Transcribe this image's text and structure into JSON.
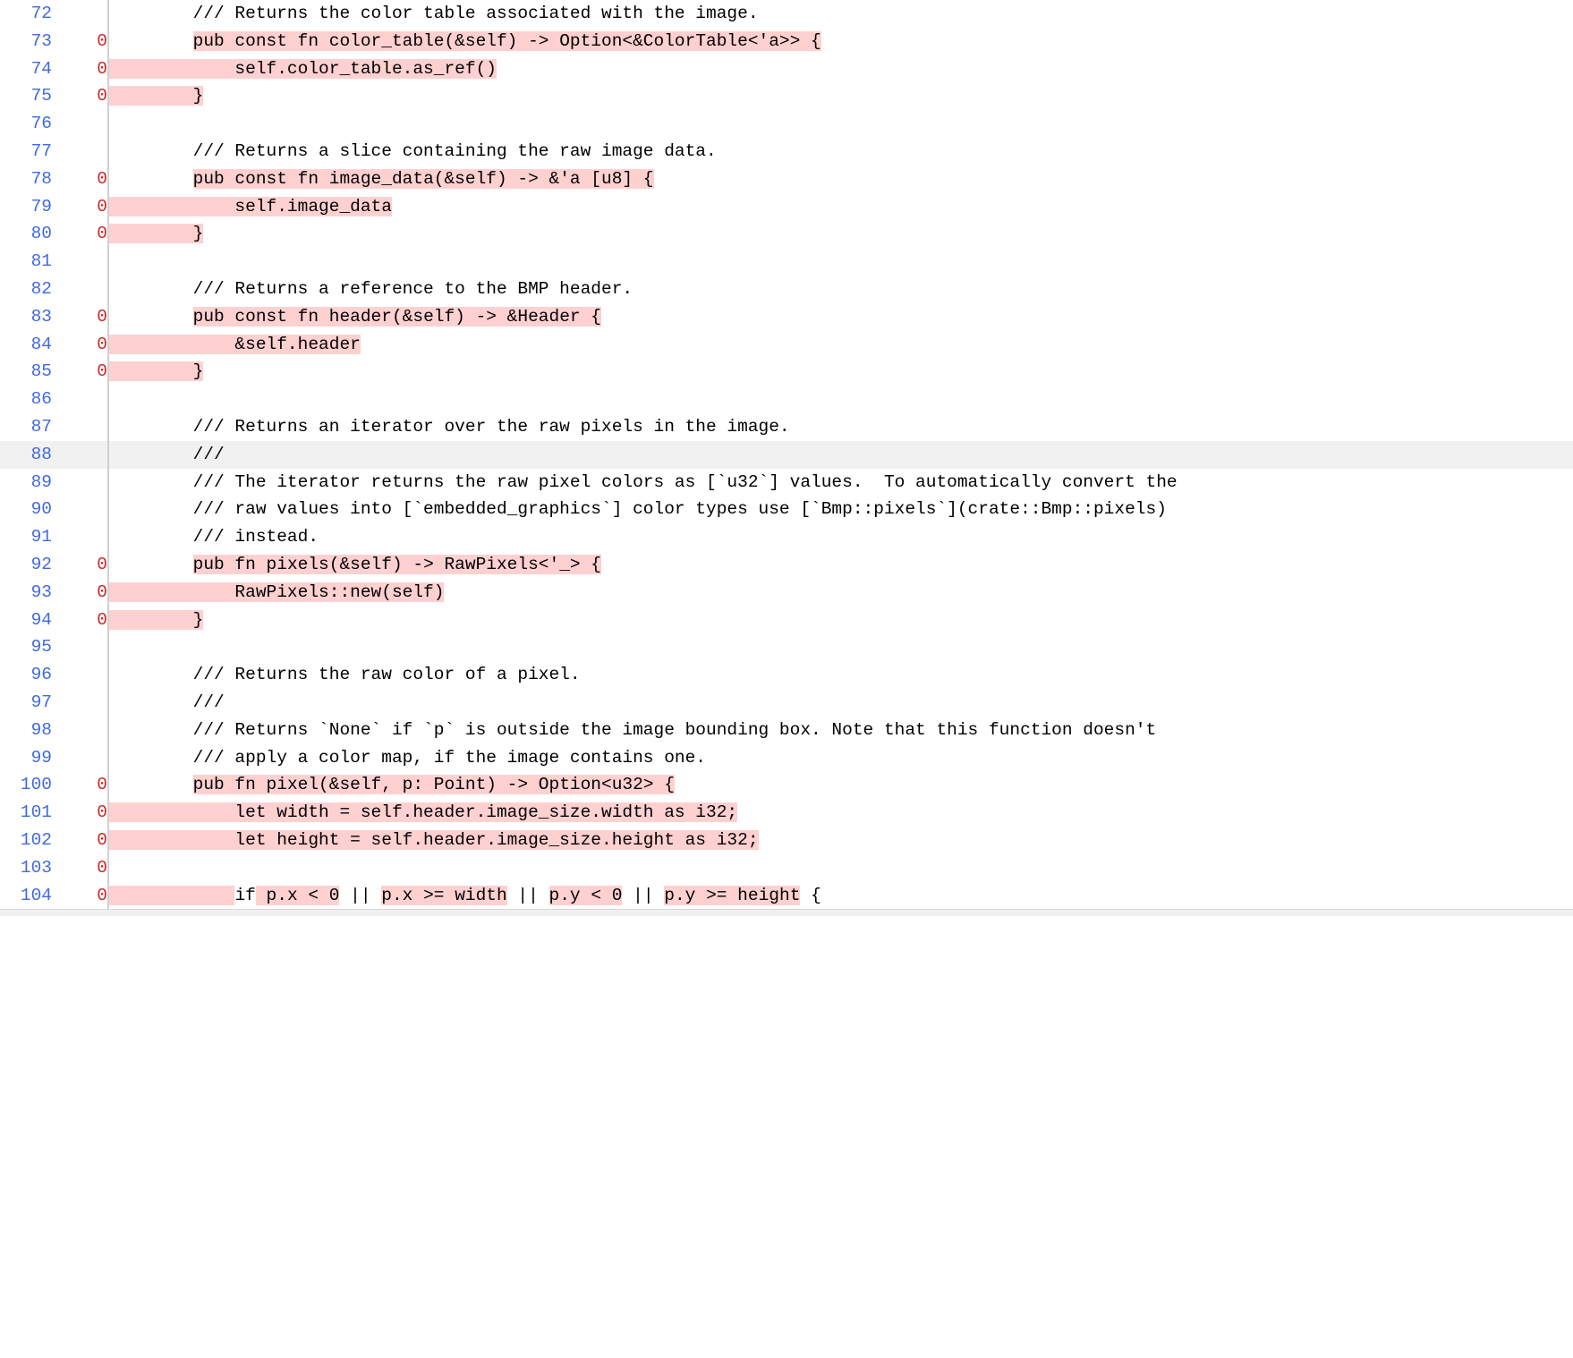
{
  "lines": [
    {
      "n": 72,
      "cov": "",
      "segments": [
        {
          "t": "        /// Returns the color table associated with the image.",
          "hl": false
        }
      ]
    },
    {
      "n": 73,
      "cov": "0",
      "segments": [
        {
          "t": "        ",
          "hl": false
        },
        {
          "t": "pub const fn color_table(&self) -> Option<&ColorTable<'a>> {",
          "hl": true
        }
      ]
    },
    {
      "n": 74,
      "cov": "0",
      "segments": [
        {
          "t": "            self.color_table.as_ref()",
          "hl": true
        }
      ]
    },
    {
      "n": 75,
      "cov": "0",
      "segments": [
        {
          "t": "        }",
          "hl": true
        }
      ]
    },
    {
      "n": 76,
      "cov": "",
      "segments": [
        {
          "t": "",
          "hl": false
        }
      ]
    },
    {
      "n": 77,
      "cov": "",
      "segments": [
        {
          "t": "        /// Returns a slice containing the raw image data.",
          "hl": false
        }
      ]
    },
    {
      "n": 78,
      "cov": "0",
      "segments": [
        {
          "t": "        ",
          "hl": false
        },
        {
          "t": "pub const fn image_data(&self) -> &'a [u8] {",
          "hl": true
        }
      ]
    },
    {
      "n": 79,
      "cov": "0",
      "segments": [
        {
          "t": "            self.image_data",
          "hl": true
        }
      ]
    },
    {
      "n": 80,
      "cov": "0",
      "segments": [
        {
          "t": "        }",
          "hl": true
        }
      ]
    },
    {
      "n": 81,
      "cov": "",
      "segments": [
        {
          "t": "",
          "hl": false
        }
      ]
    },
    {
      "n": 82,
      "cov": "",
      "segments": [
        {
          "t": "        /// Returns a reference to the BMP header.",
          "hl": false
        }
      ]
    },
    {
      "n": 83,
      "cov": "0",
      "segments": [
        {
          "t": "        ",
          "hl": false
        },
        {
          "t": "pub const fn header(&self) -> &Header {",
          "hl": true
        }
      ]
    },
    {
      "n": 84,
      "cov": "0",
      "segments": [
        {
          "t": "            &self.header",
          "hl": true
        }
      ]
    },
    {
      "n": 85,
      "cov": "0",
      "segments": [
        {
          "t": "        }",
          "hl": true
        }
      ]
    },
    {
      "n": 86,
      "cov": "",
      "segments": [
        {
          "t": "",
          "hl": false
        }
      ]
    },
    {
      "n": 87,
      "cov": "",
      "segments": [
        {
          "t": "        /// Returns an iterator over the raw pixels in the image.",
          "hl": false
        }
      ]
    },
    {
      "n": 88,
      "cov": "",
      "hover": true,
      "segments": [
        {
          "t": "        ///",
          "hl": false
        }
      ]
    },
    {
      "n": 89,
      "cov": "",
      "segments": [
        {
          "t": "        /// The iterator returns the raw pixel colors as [`u32`] values.  To automatically convert the",
          "hl": false
        }
      ]
    },
    {
      "n": 90,
      "cov": "",
      "segments": [
        {
          "t": "        /// raw values into [`embedded_graphics`] color types use [`Bmp::pixels`](crate::Bmp::pixels)",
          "hl": false
        }
      ]
    },
    {
      "n": 91,
      "cov": "",
      "segments": [
        {
          "t": "        /// instead.",
          "hl": false
        }
      ]
    },
    {
      "n": 92,
      "cov": "0",
      "segments": [
        {
          "t": "        ",
          "hl": false
        },
        {
          "t": "pub fn pixels(&self) -> RawPixels<'_> {",
          "hl": true
        }
      ]
    },
    {
      "n": 93,
      "cov": "0",
      "segments": [
        {
          "t": "            RawPixels::new(self)",
          "hl": true
        }
      ]
    },
    {
      "n": 94,
      "cov": "0",
      "segments": [
        {
          "t": "        }",
          "hl": true
        }
      ]
    },
    {
      "n": 95,
      "cov": "",
      "segments": [
        {
          "t": "",
          "hl": false
        }
      ]
    },
    {
      "n": 96,
      "cov": "",
      "segments": [
        {
          "t": "        /// Returns the raw color of a pixel.",
          "hl": false
        }
      ]
    },
    {
      "n": 97,
      "cov": "",
      "segments": [
        {
          "t": "        ///",
          "hl": false
        }
      ]
    },
    {
      "n": 98,
      "cov": "",
      "segments": [
        {
          "t": "        /// Returns `None` if `p` is outside the image bounding box. Note that this function doesn't",
          "hl": false
        }
      ]
    },
    {
      "n": 99,
      "cov": "",
      "segments": [
        {
          "t": "        /// apply a color map, if the image contains one.",
          "hl": false
        }
      ]
    },
    {
      "n": 100,
      "cov": "0",
      "segments": [
        {
          "t": "        ",
          "hl": false
        },
        {
          "t": "pub fn pixel(&self, p: Point) -> Option<u32> {",
          "hl": true
        }
      ]
    },
    {
      "n": 101,
      "cov": "0",
      "segments": [
        {
          "t": "            let width = self.header.image_size.width as i32;",
          "hl": true
        }
      ]
    },
    {
      "n": 102,
      "cov": "0",
      "segments": [
        {
          "t": "            let height = self.header.image_size.height as i32;",
          "hl": true
        }
      ]
    },
    {
      "n": 103,
      "cov": "0",
      "segments": [
        {
          "t": "",
          "hl": false
        }
      ]
    },
    {
      "n": 104,
      "cov": "0",
      "segments": [
        {
          "t": "            ",
          "hl": true
        },
        {
          "t": "if",
          "hl": false
        },
        {
          "t": " ",
          "hl": true
        },
        {
          "t": "p.x < 0",
          "hl": true
        },
        {
          "t": " || ",
          "hl": false
        },
        {
          "t": "p.x >= width",
          "hl": true
        },
        {
          "t": " || ",
          "hl": false
        },
        {
          "t": "p.y < 0",
          "hl": true
        },
        {
          "t": " || ",
          "hl": false
        },
        {
          "t": "p.y >= height",
          "hl": true
        },
        {
          "t": " {",
          "hl": false
        }
      ]
    }
  ]
}
